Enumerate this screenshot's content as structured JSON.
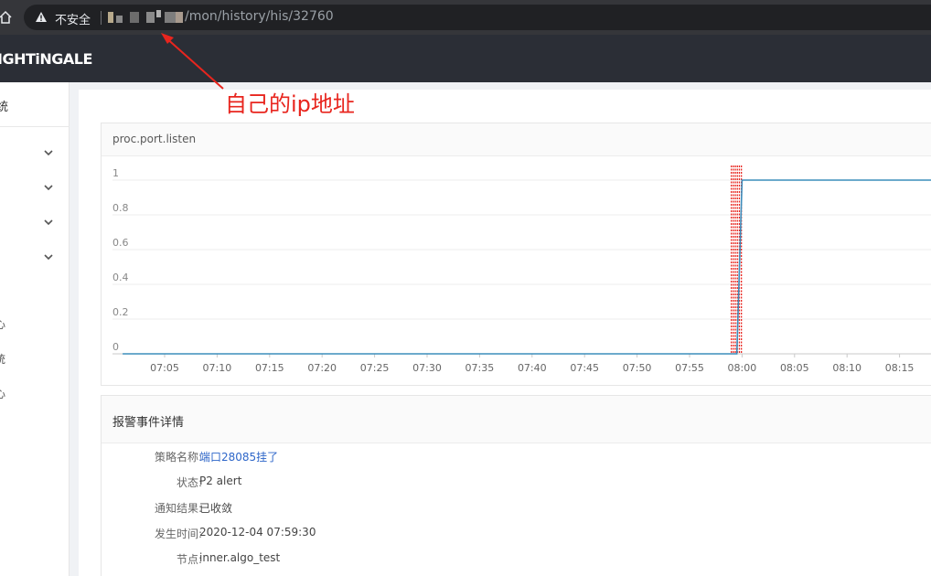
{
  "browser": {
    "insecure_label": "不安全",
    "url_suffix": "/mon/history/his/32760"
  },
  "app": {
    "brand": "IGHTiNGALE"
  },
  "sidebar": {
    "top_item": "统",
    "bottom_items": [
      "心",
      "统",
      "心"
    ]
  },
  "annotation": {
    "text": "自己的ip地址"
  },
  "chart_data": {
    "type": "line",
    "title": "proc.port.listen",
    "x_ticks": [
      "07:05",
      "07:10",
      "07:15",
      "07:20",
      "07:25",
      "07:30",
      "07:35",
      "07:40",
      "07:45",
      "07:50",
      "07:55",
      "08:00",
      "08:05",
      "08:10",
      "08:15"
    ],
    "y_ticks": [
      "0",
      "0.2",
      "0.4",
      "0.6",
      "0.8",
      "1"
    ],
    "ylim": [
      0,
      1
    ],
    "series": [
      {
        "color": "#3c8dbc",
        "points": [
          [
            "07:01",
            0
          ],
          [
            "07:59:30",
            0
          ],
          [
            "08:00",
            1
          ],
          [
            "08:18",
            1
          ]
        ]
      }
    ],
    "event_marker": {
      "time": "07:59:30",
      "color": "#e8251e"
    }
  },
  "detail": {
    "title": "报警事件详情",
    "rows": [
      {
        "label": "策略名称:",
        "value": "端口28085挂了",
        "link": true
      },
      {
        "label": "状态:",
        "value": "P2  alert",
        "link": false
      },
      {
        "label": "通知结果:",
        "value": "已收敛",
        "link": false
      },
      {
        "label": "发生时间:",
        "value": "2020-12-04 07:59:30",
        "link": false
      },
      {
        "label": "节点:",
        "value": "inner.algo_test",
        "link": false
      }
    ]
  },
  "colors": {
    "header_bg": "#2b2e36",
    "link": "#2e66c9",
    "annotation": "#e8251e",
    "series": "#3c8dbc"
  }
}
